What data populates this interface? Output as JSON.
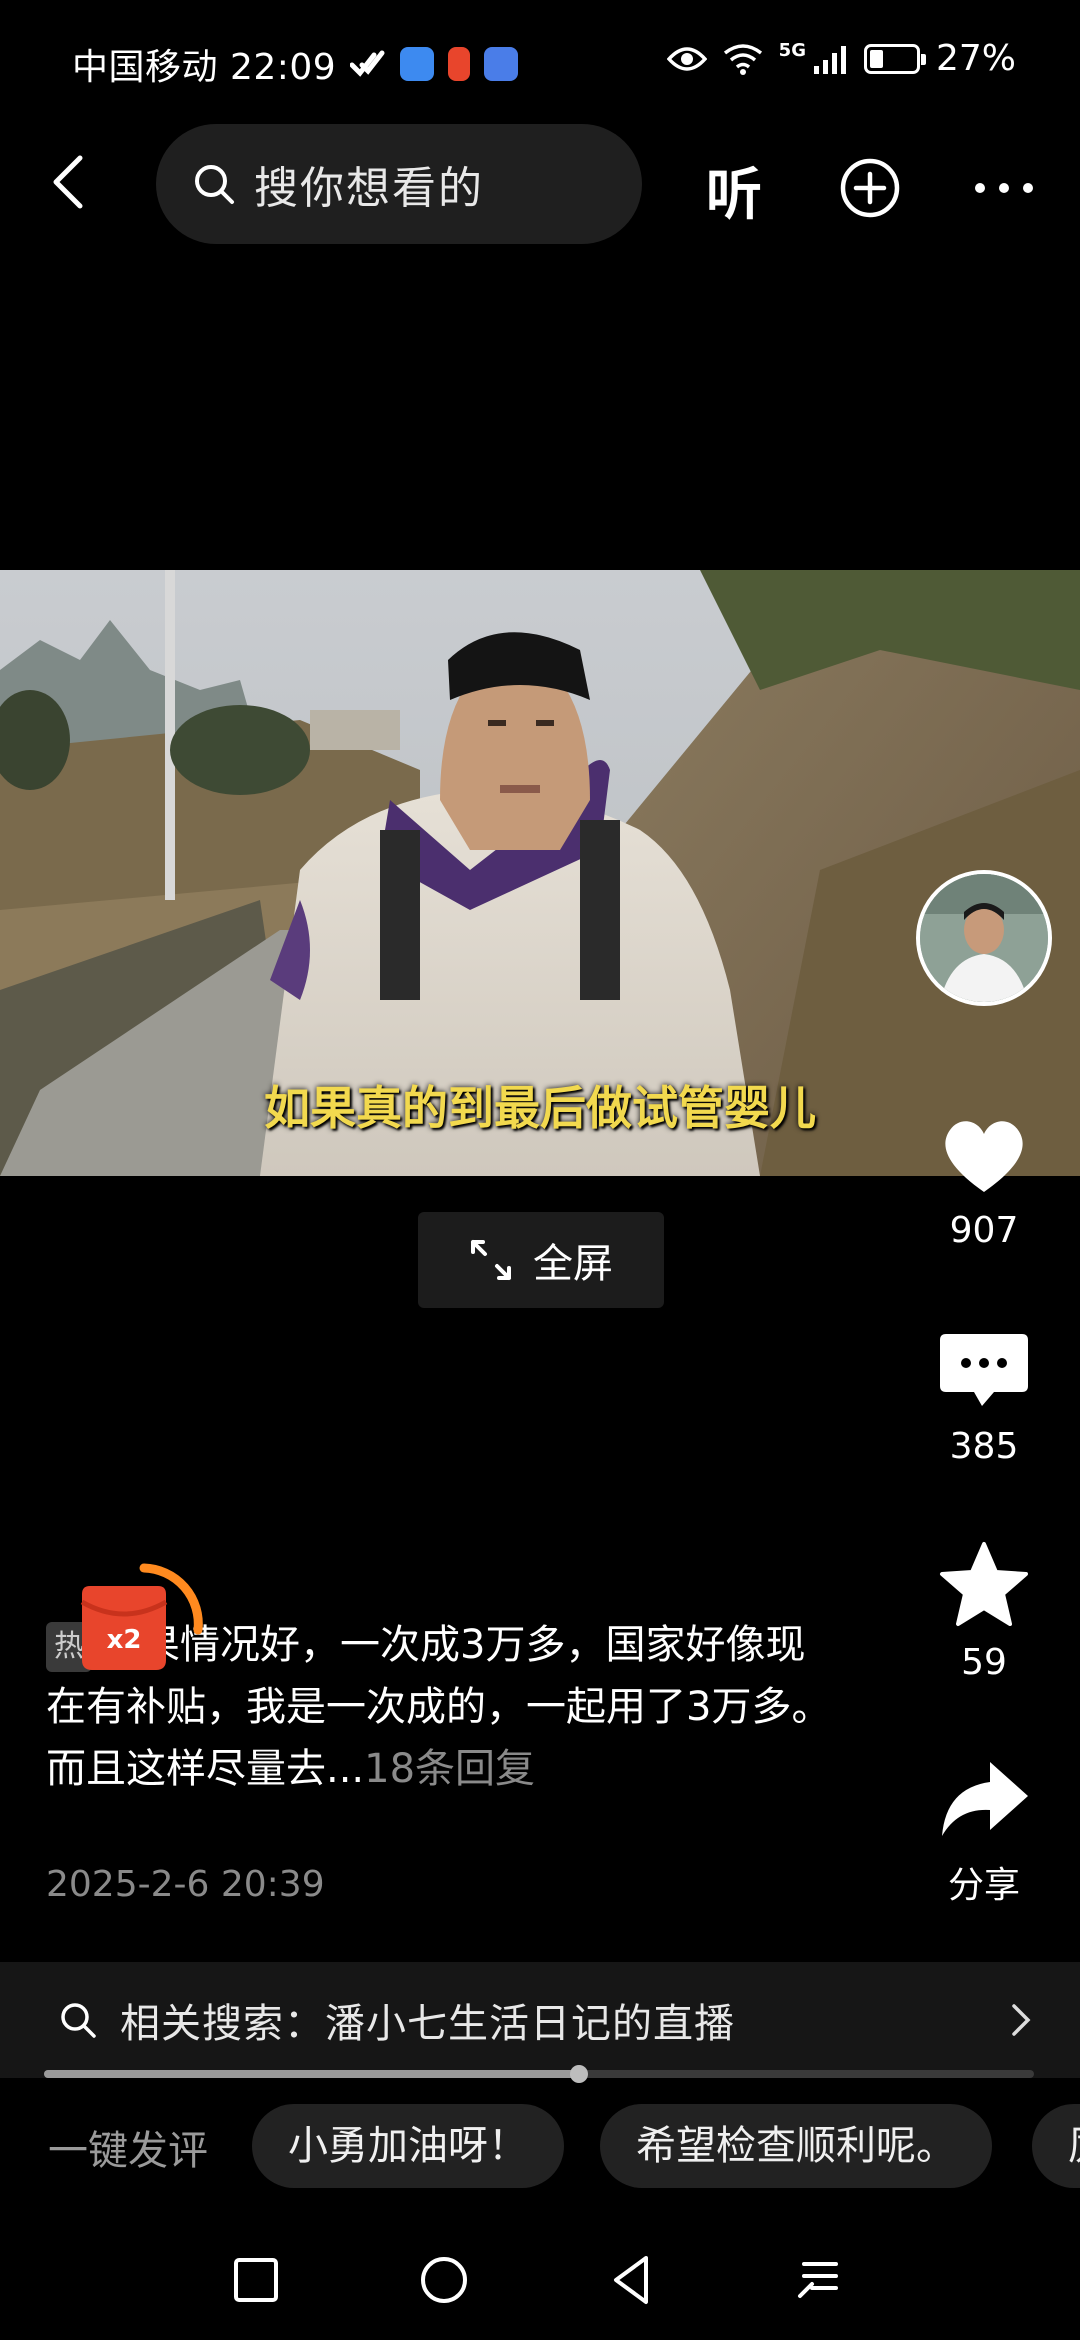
{
  "status_bar": {
    "carrier_time": "中国移动 22:09",
    "network": "5G",
    "battery_level": 0.27,
    "battery_text": "27%"
  },
  "top_nav": {
    "search_placeholder": "搜你想看的",
    "listen_label": "听"
  },
  "video": {
    "subtitle": "如果真的到最后做试管婴儿",
    "fullscreen_label": "全屏"
  },
  "actions": {
    "likes": "907",
    "comments": "385",
    "favorites": "59",
    "share_label": "分享"
  },
  "comment": {
    "tag": "热",
    "text": "如果情况好，一次成3万多，国家好像现在有补贴，我是一次成的，一起用了3万多。而且这样尽量去...",
    "replies": "18条回复",
    "date": "2025-2-6 20:39",
    "redpacket_label": "x2"
  },
  "related_search": {
    "text": "相关搜索：潘小七生活日记的直播"
  },
  "progress": {
    "value": 0.54
  },
  "quick_comments": {
    "label": "一键发评",
    "chips": [
      "小勇加油呀！",
      "希望检查顺利呢。",
      "厉"
    ]
  },
  "colors": {
    "background": "#000000",
    "subtitle": "#f2d94e",
    "redpacket": "#e8452c"
  }
}
